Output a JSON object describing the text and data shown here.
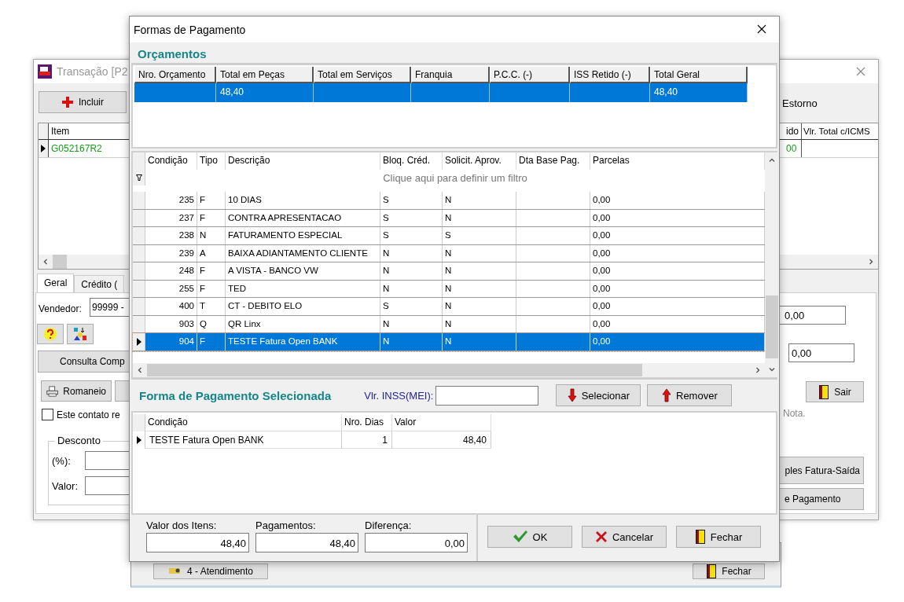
{
  "background_window": {
    "title": "Transação [P2",
    "toolbar": [
      {
        "label": "Incluir"
      },
      {
        "label": "Estorno"
      }
    ],
    "grid": {
      "columns": [
        "Item",
        "ido",
        "Vlr. Total c/ICMS"
      ],
      "rows": [
        {
          "cells": [
            "G052167R2",
            "00",
            null
          ],
          "selected": true
        }
      ]
    },
    "tabs": [
      {
        "label": "Geral",
        "selected": true
      },
      {
        "label": "Crédito (",
        "selected": false
      }
    ],
    "vendedor": {
      "label": "Vendedor:",
      "value": "99999 -"
    },
    "consulta_button": "Consulta Comp",
    "print_button": "Romaneio",
    "contact_checkbox": {
      "label": "Este contato re",
      "checked": false
    },
    "desconto": {
      "title": "Desconto",
      "fields": [
        {
          "label": "(%):"
        },
        {
          "label": "Valor:"
        }
      ]
    },
    "right_fields": [
      {
        "value": "0,00"
      },
      {
        "value": "0,00"
      }
    ],
    "sair_button": "Sair",
    "note": "Nota.",
    "right_buttons": [
      "ples Fatura-Saída",
      "e Pagamento"
    ]
  },
  "dialog": {
    "title": "Formas de Pagamento",
    "orcamentos": {
      "title": "Orçamentos",
      "columns": [
        "Nro. Orçamento",
        "Total em Peças",
        "Total em Serviços",
        "Franquia",
        "P.C.C. (-)",
        "ISS Retido (-)",
        "Total Geral"
      ],
      "rows": [
        {
          "cells": [
            null,
            "48,40",
            null,
            null,
            null,
            null,
            "48,40"
          ],
          "selected": true
        }
      ]
    },
    "condicoes": {
      "columns": [
        "Condição",
        "Tipo",
        "Descrição",
        "Bloq. Créd.",
        "Solicit. Aprov.",
        "Dta Base Pag.",
        "Parcelas"
      ],
      "filter_hint": "Clique aqui para definir um filtro",
      "rows": [
        {
          "cells": [
            "235",
            "F",
            "10 DIAS",
            "S",
            "N",
            null,
            "0,00"
          ],
          "selected": false
        },
        {
          "cells": [
            "237",
            "F",
            "CONTRA APRESENTACAO",
            "S",
            "N",
            null,
            "0,00"
          ],
          "selected": false
        },
        {
          "cells": [
            "238",
            "N",
            "FATURAMENTO ESPECIAL",
            "S",
            "S",
            null,
            "0,00"
          ],
          "selected": false
        },
        {
          "cells": [
            "239",
            "A",
            "BAIXA ADIANTAMENTO CLIENTE",
            "N",
            "N",
            null,
            "0,00"
          ],
          "selected": false
        },
        {
          "cells": [
            "248",
            "F",
            "A VISTA - BANCO VW",
            "N",
            "N",
            null,
            "0,00"
          ],
          "selected": false
        },
        {
          "cells": [
            "255",
            "F",
            "TED",
            "N",
            "N",
            null,
            "0,00"
          ],
          "selected": false
        },
        {
          "cells": [
            "400",
            "T",
            "CT - DEBITO ELO",
            "S",
            "N",
            null,
            "0,00"
          ],
          "selected": false
        },
        {
          "cells": [
            "903",
            "Q",
            "QR Linx",
            "N",
            "N",
            null,
            "0,00"
          ],
          "selected": false
        },
        {
          "cells": [
            "904",
            "F",
            "TESTE Fatura Open BANK",
            "N",
            "N",
            null,
            "0,00"
          ],
          "selected": true
        }
      ]
    },
    "selecionada": {
      "title": "Forma de Pagamento Selecionada",
      "inss_label": "Vlr. INSS(MEI):",
      "buttons": [
        {
          "label": "Selecionar"
        },
        {
          "label": "Remover"
        }
      ],
      "columns": [
        "Condição",
        "Nro. Dias",
        "Valor"
      ],
      "rows": [
        {
          "cells": [
            "TESTE Fatura Open BANK",
            "1",
            "48,40"
          ],
          "selected": true
        }
      ]
    },
    "totals": [
      {
        "label": "Valor dos Itens:",
        "value": "48,40"
      },
      {
        "label": "Pagamentos:",
        "value": "48,40"
      },
      {
        "label": "Diferença:",
        "value": "0,00"
      }
    ],
    "buttons": [
      {
        "label": "OK"
      },
      {
        "label": "Cancelar"
      },
      {
        "label": "Fechar"
      }
    ]
  },
  "back_window": {
    "buttons": [
      {
        "label": "4 - Atendimento"
      },
      {
        "label": "Fechar"
      }
    ]
  }
}
